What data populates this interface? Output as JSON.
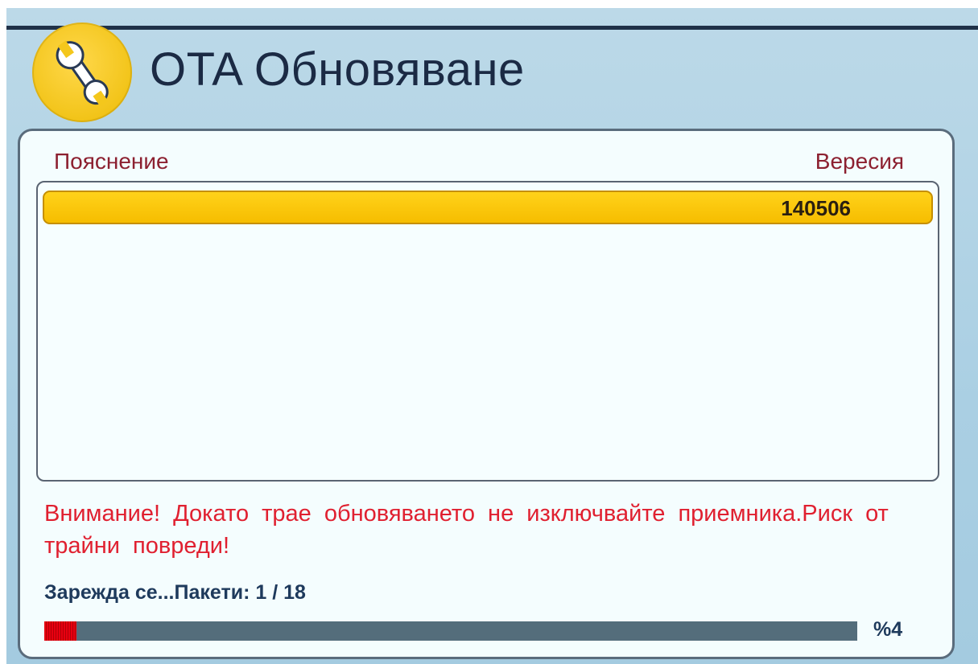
{
  "header": {
    "icon": "wrench-icon",
    "title": "OTA Обновяване"
  },
  "table": {
    "columns": [
      "Пояснение",
      "Вересия"
    ],
    "rows": [
      {
        "description": "",
        "version": "140506",
        "selected": true
      }
    ]
  },
  "warning": "Внимание! Докато трае обновяването не изключвайте приемника.Риск от трайни повреди!",
  "status": {
    "loading_text": "Зарежда се...Пакети:  1  /  18",
    "progress_percent": 4,
    "progress_label": "%4"
  },
  "colors": {
    "accent_yellow": "#f6bd00",
    "warning_red": "#e02030",
    "header_red": "#8c2030",
    "progress_red": "#e80010",
    "progress_track": "#546d7b"
  }
}
